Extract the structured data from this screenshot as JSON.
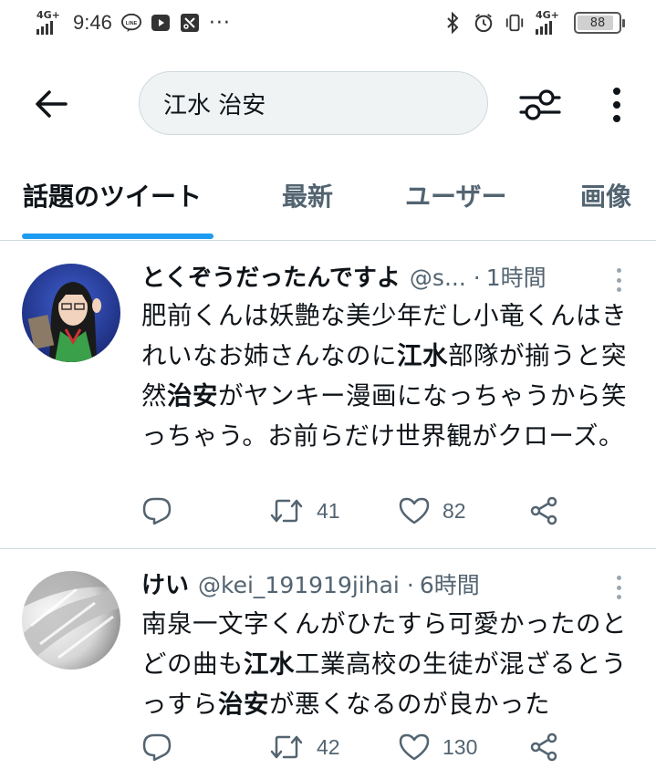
{
  "status_bar": {
    "network_label": "4G+",
    "time": "9:46",
    "right_network_label": "4G+",
    "battery": "88",
    "battery_level_percent": 88,
    "icons": [
      "signal-icon",
      "line-app-icon",
      "youtube-icon",
      "screenshot-app-icon",
      "more-notifications-icon",
      "bluetooth-icon",
      "alarm-icon",
      "vibrate-icon",
      "battery-icon"
    ]
  },
  "search": {
    "query": "江水 治安",
    "back_icon": "arrow-left-icon",
    "filter_icon": "sliders-icon",
    "more_icon": "vertical-dots-icon"
  },
  "tabs": [
    {
      "label": "話題のツイート",
      "active": true
    },
    {
      "label": "最新",
      "active": false
    },
    {
      "label": "ユーザー",
      "active": false
    },
    {
      "label": "画像",
      "active": false
    }
  ],
  "accent_color": "#1d9bf0",
  "tweets": [
    {
      "name": "とくぞうだったんですよ",
      "handle": "@s...",
      "separator": "·",
      "time": "1時間",
      "body_parts": [
        {
          "text": "肥前くんは妖艶な美少年だし小竜くんはきれいなお姉さんなのに",
          "bold": false
        },
        {
          "text": "江水",
          "bold": true
        },
        {
          "text": "部隊が揃うと突然",
          "bold": false
        },
        {
          "text": "治安",
          "bold": true
        },
        {
          "text": "がヤンキー漫画になっちゃうから笑っちゃう。お前らだけ世界観がクローズ。",
          "bold": false
        }
      ],
      "retweets": "41",
      "likes": "82"
    },
    {
      "name": "けい",
      "handle": "@kei_191919jihai",
      "separator": "·",
      "time": "6時間",
      "body_parts": [
        {
          "text": "南泉一文字くんがひたすら可愛かったのとどの曲も",
          "bold": false
        },
        {
          "text": "江水",
          "bold": true
        },
        {
          "text": "工業高校の生徒が混ざるとうっすら",
          "bold": false
        },
        {
          "text": "治安",
          "bold": true
        },
        {
          "text": "が悪くなるのが良かった",
          "bold": false
        }
      ],
      "retweets": "42",
      "likes": "130"
    }
  ]
}
